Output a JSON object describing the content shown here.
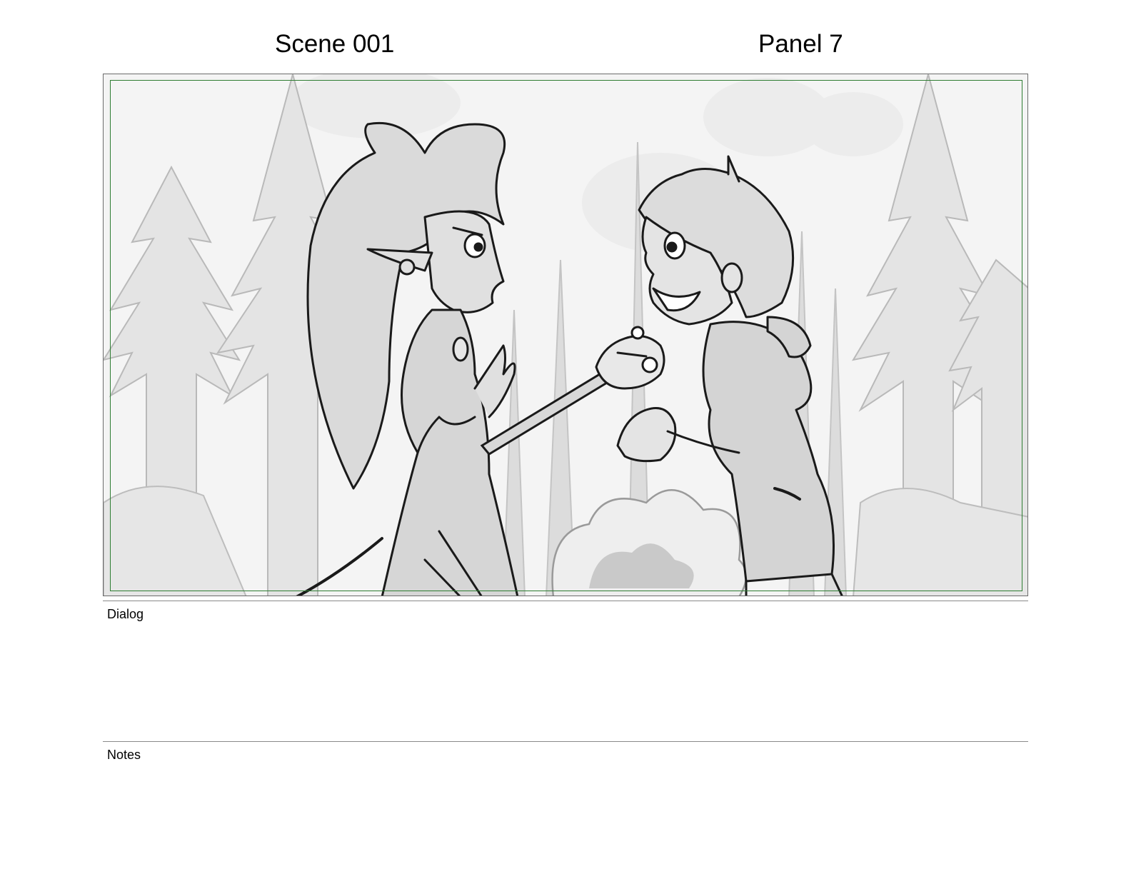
{
  "header": {
    "scene": "Scene 001",
    "panel": "Panel 7"
  },
  "panel_image": {
    "subject": "storyboard-sketch",
    "colors": {
      "frame_border": "#6b6b6b",
      "safe_area_border": "#2e7d32",
      "background_fill": "#f4f4f4",
      "tree_fill": "#e3e3e3",
      "character_fill": "#dadada",
      "line_color": "#1a1a1a"
    }
  },
  "sections": {
    "dialog_label": "Dialog",
    "notes_label": "Notes"
  }
}
